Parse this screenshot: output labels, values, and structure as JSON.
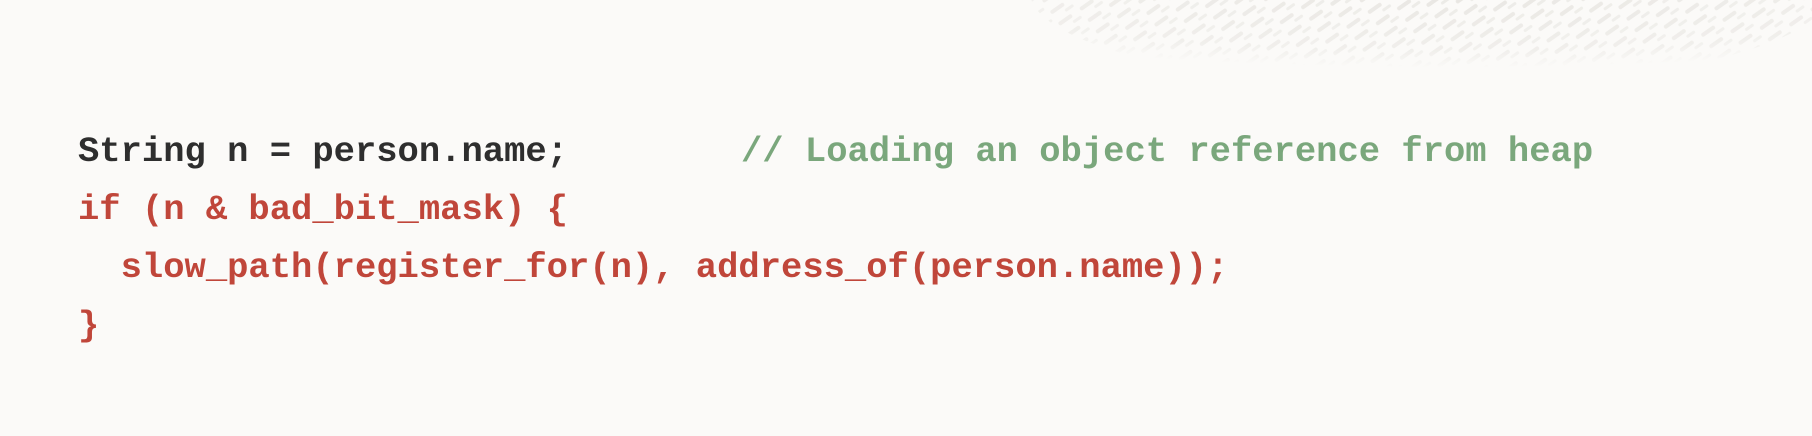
{
  "colors": {
    "background": "#fbfaf8",
    "code_default": "#2e2e2e",
    "code_highlight": "#c0463a",
    "comment": "#7aa77c",
    "decoration": "#e8e6e2"
  },
  "code": {
    "line1": {
      "statement": "String n = person.name;",
      "comment": "// Loading an object reference from heap"
    },
    "line2": "if (n & bad_bit_mask) {",
    "line3": "  slow_path(register_for(n), address_of(person.name));",
    "line4": "}"
  }
}
